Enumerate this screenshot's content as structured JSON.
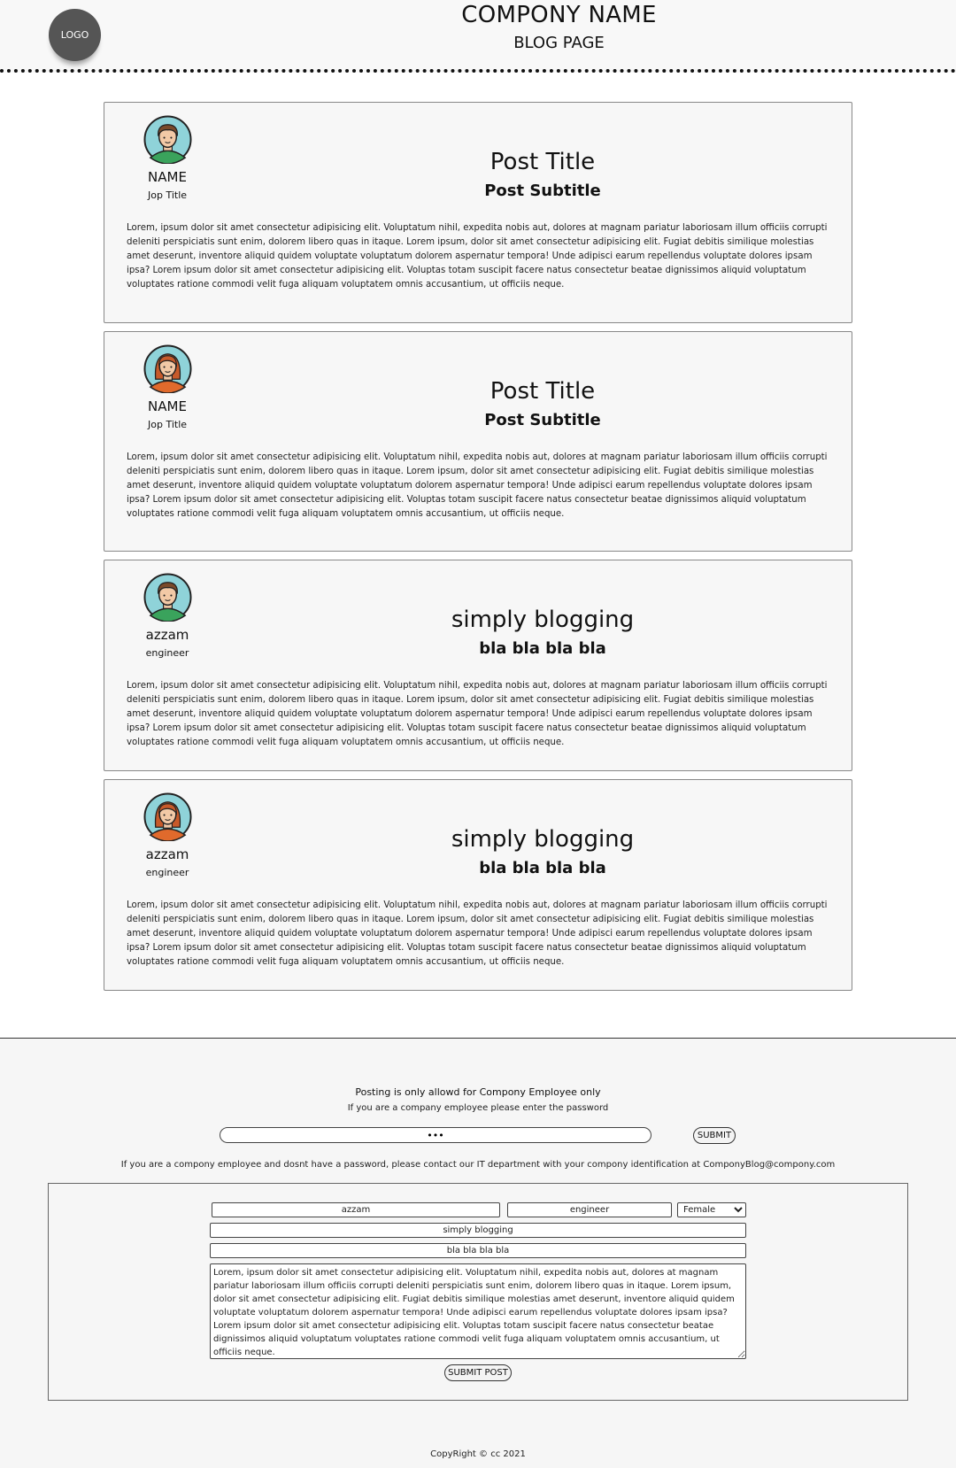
{
  "header": {
    "logo_label": "LOGO",
    "company_name": "COMPONY NAME",
    "page_name": "BLOG PAGE"
  },
  "posts": [
    {
      "author_name": "NAME",
      "author_job": "Jop Title",
      "avatar": "male-avatar-icon",
      "title": "Post Title",
      "subtitle": "Post Subtitle",
      "body": "Lorem, ipsum dolor sit amet consectetur adipisicing elit. Voluptatum nihil, expedita nobis aut, dolores at magnam pariatur laboriosam illum officiis corrupti deleniti perspiciatis sunt enim, dolorem libero quas in itaque. Lorem ipsum, dolor sit amet consectetur adipisicing elit. Fugiat debitis similique molestias amet deserunt, inventore aliquid quidem voluptate voluptatum dolorem aspernatur tempora! Unde adipisci earum repellendus voluptate dolores ipsam ipsa? Lorem ipsum dolor sit amet consectetur adipisicing elit. Voluptas totam suscipit facere natus consectetur beatae dignissimos aliquid voluptatum voluptates ratione commodi velit fuga aliquam voluptatem omnis accusantium, ut officiis neque."
    },
    {
      "author_name": "NAME",
      "author_job": "Jop Title",
      "avatar": "female-avatar-icon",
      "title": "Post Title",
      "subtitle": "Post Subtitle",
      "body": "Lorem, ipsum dolor sit amet consectetur adipisicing elit. Voluptatum nihil, expedita nobis aut, dolores at magnam pariatur laboriosam illum officiis corrupti deleniti perspiciatis sunt enim, dolorem libero quas in itaque. Lorem ipsum, dolor sit amet consectetur adipisicing elit. Fugiat debitis similique molestias amet deserunt, inventore aliquid quidem voluptate voluptatum dolorem aspernatur tempora! Unde adipisci earum repellendus voluptate dolores ipsam ipsa? Lorem ipsum dolor sit amet consectetur adipisicing elit. Voluptas totam suscipit facere natus consectetur beatae dignissimos aliquid voluptatum voluptates ratione commodi velit fuga aliquam voluptatem omnis accusantium, ut officiis neque."
    },
    {
      "author_name": "azzam",
      "author_job": "engineer",
      "avatar": "male-avatar-icon",
      "title": "simply blogging",
      "subtitle": "bla bla bla bla",
      "body": "Lorem, ipsum dolor sit amet consectetur adipisicing elit. Voluptatum nihil, expedita nobis aut, dolores at magnam pariatur laboriosam illum officiis corrupti deleniti perspiciatis sunt enim, dolorem libero quas in itaque. Lorem ipsum, dolor sit amet consectetur adipisicing elit. Fugiat debitis similique molestias amet deserunt, inventore aliquid quidem voluptate voluptatum dolorem aspernatur tempora! Unde adipisci earum repellendus voluptate dolores ipsam ipsa? Lorem ipsum dolor sit amet consectetur adipisicing elit. Voluptas totam suscipit facere natus consectetur beatae dignissimos aliquid voluptatum voluptates ratione commodi velit fuga aliquam voluptatem omnis accusantium, ut officiis neque."
    },
    {
      "author_name": "azzam",
      "author_job": "engineer",
      "avatar": "female-avatar-icon",
      "title": "simply blogging",
      "subtitle": "bla bla bla bla",
      "body": "Lorem, ipsum dolor sit amet consectetur adipisicing elit. Voluptatum nihil, expedita nobis aut, dolores at magnam pariatur laboriosam illum officiis corrupti deleniti perspiciatis sunt enim, dolorem libero quas in itaque. Lorem ipsum, dolor sit amet consectetur adipisicing elit. Fugiat debitis similique molestias amet deserunt, inventore aliquid quidem voluptate voluptatum dolorem aspernatur tempora! Unde adipisci earum repellendus voluptate dolores ipsam ipsa? Lorem ipsum dolor sit amet consectetur adipisicing elit. Voluptas totam suscipit facere natus consectetur beatae dignissimos aliquid voluptatum voluptates ratione commodi velit fuga aliquam voluptatem omnis accusantium, ut officiis neque."
    }
  ],
  "auth": {
    "notice": "Posting is only allowd for Compony Employee only",
    "instruction": "If you are a company employee please enter the password",
    "password_value": "•••",
    "submit_label": "SUBMIT",
    "contact_notice": "If you are a compony employee and dosnt have a password, please contact our IT department with your compony identification at ComponyBlog@compony.com"
  },
  "post_form": {
    "name_value": "azzam",
    "job_value": "engineer",
    "gender_selected": "Female",
    "title_value": "simply blogging",
    "subtitle_value": "bla bla bla bla",
    "body_value": "Lorem, ipsum dolor sit amet consectetur adipisicing elit. Voluptatum nihil, expedita nobis aut, dolores at magnam pariatur laboriosam illum officiis corrupti deleniti perspiciatis sunt enim, dolorem libero quas in itaque. Lorem ipsum, dolor sit amet consectetur adipisicing elit. Fugiat debitis similique molestias amet deserunt, inventore aliquid quidem voluptate voluptatum dolorem aspernatur tempora! Unde adipisci earum repellendus voluptate dolores ipsam ipsa? Lorem ipsum dolor sit amet consectetur adipisicing elit. Voluptas totam suscipit facere natus consectetur beatae dignissimos aliquid voluptatum voluptates ratione commodi velit fuga aliquam voluptatem omnis accusantium, ut officiis neque.",
    "submit_label": "SUBMIT POST"
  },
  "footer": {
    "copyright": "CopyRight © cc 2021"
  },
  "colors": {
    "avatar_bg": "#8fd3d9",
    "male_shirt": "#3aa35c",
    "female_shirt": "#e06a2c",
    "male_hair": "#7a4a2a",
    "female_hair": "#c75a2a",
    "skin": "#f2c9a6"
  }
}
